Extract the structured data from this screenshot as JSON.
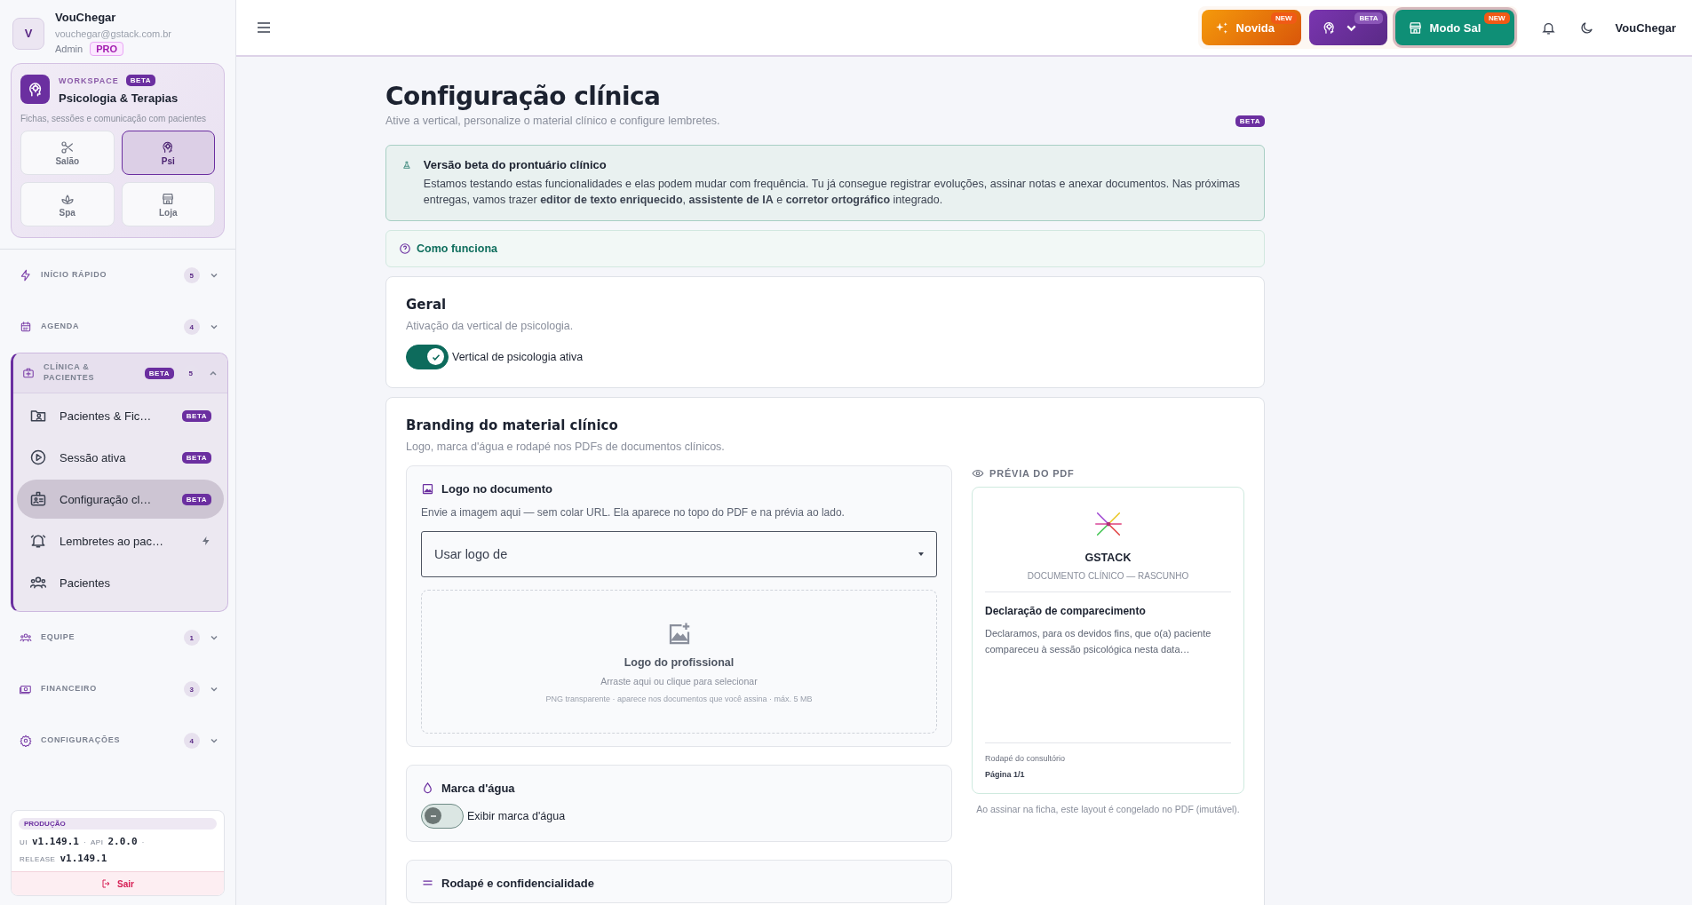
{
  "user": {
    "avatar": "V",
    "name": "VouChegar",
    "email": "vouchegar@gstack.com.br",
    "role": "Admin",
    "plan": "PRO"
  },
  "workspace": {
    "eyebrow": "WORKSPACE",
    "badge": "BETA",
    "title": "Psicologia & Terapias",
    "description": "Fichas, sessões e comunicação com pacientes",
    "verticals": [
      {
        "label": "Salão",
        "selected": false
      },
      {
        "label": "Psi",
        "selected": true
      },
      {
        "label": "Spa",
        "selected": false
      },
      {
        "label": "Loja",
        "selected": false
      }
    ]
  },
  "nav": [
    {
      "label": "INÍCIO RÁPIDO",
      "count": "5",
      "expanded": false
    },
    {
      "label": "AGENDA",
      "count": "4",
      "expanded": false
    },
    {
      "label": "CLÍNICA & PACIENTES",
      "badge": "BETA",
      "count": "5",
      "expanded": true,
      "children": [
        {
          "label": "Pacientes & Fic…",
          "kind": "beta",
          "badge": "BETA",
          "selected": false
        },
        {
          "label": "Sessão ativa",
          "kind": "beta",
          "badge": "BETA",
          "selected": false
        },
        {
          "label": "Configuração cl…",
          "kind": "beta",
          "badge": "BETA",
          "selected": true
        },
        {
          "label": "Lembretes ao pac…",
          "kind": "bolt",
          "selected": false
        },
        {
          "label": "Pacientes",
          "kind": "plain",
          "selected": false
        }
      ]
    },
    {
      "label": "EQUIPE",
      "count": "1",
      "expanded": false
    },
    {
      "label": "FINANCEIRO",
      "count": "3",
      "expanded": false
    },
    {
      "label": "CONFIGURAÇÕES",
      "count": "4",
      "expanded": false
    }
  ],
  "build": {
    "env": "PRODUÇÃO",
    "lines": [
      [
        {
          "text": "UI",
          "kind": "key"
        },
        {
          "text": "v1.149.1",
          "kind": "value"
        },
        {
          "text": "·",
          "kind": "sep"
        },
        {
          "text": "API",
          "kind": "key"
        },
        {
          "text": "2.0.0",
          "kind": "value"
        },
        {
          "text": "·",
          "kind": "sep"
        }
      ],
      [
        {
          "text": "RELEASE",
          "kind": "key"
        },
        {
          "text": "v1.149.1",
          "kind": "value"
        }
      ]
    ],
    "logout": "Sair"
  },
  "topbar": {
    "buttons": [
      {
        "kind": "news",
        "label": "Novida",
        "badge": "NEW"
      },
      {
        "kind": "vertical",
        "badge": "BETA"
      },
      {
        "kind": "salon",
        "label": "Modo Sal",
        "badge": "NEW"
      }
    ],
    "username": "VouChegar"
  },
  "page": {
    "title": "Configuração clínica",
    "subtitle": "Ative a vertical, personalize o material clínico e configure lembretes.",
    "badge": "BETA"
  },
  "alert": {
    "title": "Versão beta do prontuário clínico",
    "text": "Estamos testando estas funcionalidades e elas podem mudar com frequência. Tu já consegue registrar evoluções, assinar notas e anexar documentos. Nas próximas entregas, vamos trazer **editor de texto enriquecido**, **assistente de IA** e **corretor ortográfico** integrado."
  },
  "how_it_works": "Como funciona",
  "general": {
    "title": "Geral",
    "subtitle": "Ativação da vertical de psicologia.",
    "toggle": {
      "label": "Vertical de psicologia ativa",
      "on": true
    }
  },
  "branding": {
    "title": "Branding do material clínico",
    "subtitle": "Logo, marca d'água e rodapé nos PDFs de documentos clínicos.",
    "logo": {
      "title": "Logo no documento",
      "description": "Envie a imagem aqui — sem colar URL. Ela aparece no topo do PDF e na prévia ao lado.",
      "select": {
        "value": "Usar logo de"
      },
      "dropzone": {
        "title": "Logo do profissional",
        "hint": "Arraste aqui ou clique para selecionar",
        "note": "PNG transparente · aparece nos documentos que você assina · máx. 5 MB"
      }
    },
    "watermark": {
      "title": "Marca d'água",
      "toggle": {
        "label": "Exibir marca d'água",
        "on": false
      }
    },
    "footer_section": {
      "title": "Rodapé e confidencialidade"
    },
    "preview": {
      "heading": "PRÉVIA DO PDF",
      "brand": "GSTACK",
      "doc_kind": "DOCUMENTO CLÍNICO — RASCUNHO",
      "doc_title": "Declaração de comparecimento",
      "doc_body": "Declaramos, para os devidos fins, que o(a) paciente compareceu à sessão psicológica nesta data…",
      "footer_label": "Rodapé do consultório",
      "page": "Página 1/1",
      "caption": "Ao assinar na ficha, este layout é congelado no PDF (imutável)."
    }
  }
}
